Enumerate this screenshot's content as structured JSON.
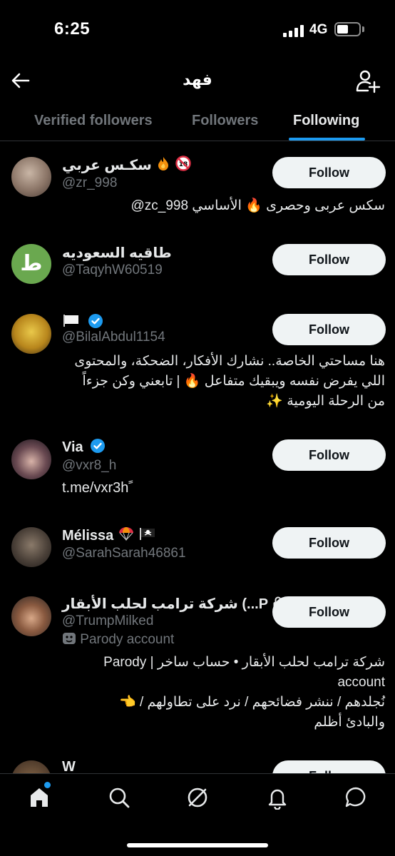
{
  "status_bar": {
    "time": "6:25",
    "network": "4G"
  },
  "header": {
    "title": "فهد"
  },
  "tabs": [
    {
      "label": "Verified followers",
      "active": false
    },
    {
      "label": "Followers",
      "active": false
    },
    {
      "label": "Following",
      "active": true
    }
  ],
  "users": [
    {
      "name": "سكـس عربي",
      "handle": "@zr_998",
      "bio": "سكس عربى وحصرى 🔥 الأساسي zc_998@",
      "button": "Follow"
    },
    {
      "name": "طاقيه السعوديه",
      "handle": "@TaqyhW60519",
      "button": "Follow",
      "avatar_letter": "ط"
    },
    {
      "name": "🏳️",
      "handle": "@BilalAbdul1154",
      "bio_lines": [
        "هنا مساحتي الخاصة.. نشارك الأفكار، الضحكة، والمحتوى",
        "اللي يفرض نفسه ويبقيك متفاعل 🔥 | تابعني وكن جزءاً",
        "من الرحلة اليومية ✨"
      ],
      "button": "Follow"
    },
    {
      "name": "Via",
      "handle": "@vxr8_h",
      "bio": "t.me/vxr3h ً",
      "button": "Follow"
    },
    {
      "name": "Mélissa",
      "handle": "@SarahSarah46861",
      "button": "Follow"
    },
    {
      "name": "شركة ترامب لحلب الأبقار (...P",
      "handle": "@TrumpMilked",
      "parody_label": "Parody account",
      "bio_lines": [
        "شركة ترامب لحلب الأبقار • حساب ساخر | Parody",
        "account",
        "نُجلدهم / ننشر فضائحهم / نرد على تطاولهم / 👈",
        "والبادئ أظلم"
      ],
      "button": "Follow"
    },
    {
      "name": "W",
      "button": "Follow"
    }
  ],
  "colors": {
    "accent": "#1d9bf0",
    "background": "#000000",
    "text": "#e7e9ea",
    "muted": "#71767b",
    "button_bg": "#eff3f4"
  }
}
